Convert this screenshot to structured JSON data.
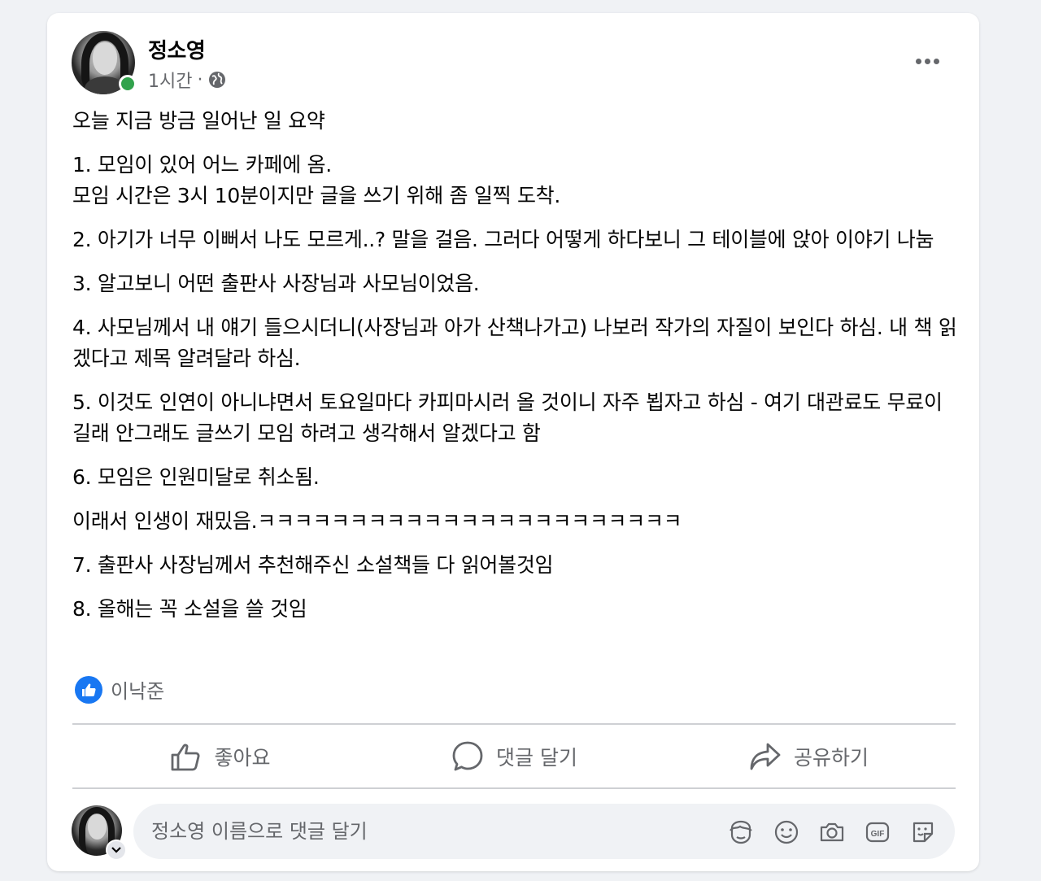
{
  "post": {
    "author": "정소영",
    "time": "1시간",
    "separator": "·",
    "paragraphs": [
      "오늘 지금 방금 일어난 일 요약",
      "1. 모임이 있어 어느 카페에 옴.\n모임 시간은 3시 10분이지만 글을 쓰기 위해 좀 일찍 도착.",
      "2. 아기가 너무 이뻐서 나도 모르게..? 말을 걸음. 그러다 어떻게 하다보니 그 테이블에 앉아 이야기 나눔",
      "3. 알고보니 어떤 출판사 사장님과 사모님이었음.",
      "4. 사모님께서 내 얘기 들으시더니(사장님과 아가 산책나가고) 나보러 작가의 자질이 보인다 하심. 내 책 읽겠다고 제목 알려달라 하심.",
      "5. 이것도 인연이 아니냐면서 토요일마다 카피마시러 올 것이니 자주 뵙자고 하심 - 여기 대관료도 무료이길래 안그래도 글쓰기 모임 하려고 생각해서 알겠다고 함",
      "6. 모임은 인원미달로 취소됨.",
      "이래서 인생이 재밌음.ㅋㅋㅋㅋㅋㅋㅋㅋㅋㅋㅋㅋㅋㅋㅋㅋㅋㅋㅋㅋㅋㅋㅋ",
      "7. 출판사 사장님께서 추천해주신 소설책들 다 읽어볼것임",
      "8. 올해는 꼭 소설을 쓸 것임"
    ]
  },
  "reactions": {
    "reactor": "이낙준"
  },
  "actions": {
    "like": "좋아요",
    "comment": "댓글 달기",
    "share": "공유하기"
  },
  "comment": {
    "placeholder": "정소영 이름으로 댓글 달기"
  },
  "icons": {
    "globe": "globe-icon",
    "more": "more-options-icon",
    "like": "thumbs-up-icon",
    "comment": "speech-bubble-icon",
    "share": "share-arrow-icon",
    "avatar_sticker": "avatar-sticker-icon",
    "emoji": "emoji-icon",
    "camera": "camera-icon",
    "gif": "gif-icon",
    "sticker": "sticker-icon"
  },
  "colors": {
    "online": "#31a24c",
    "like_blue": "#1877f2",
    "secondary_text": "#65676b"
  }
}
